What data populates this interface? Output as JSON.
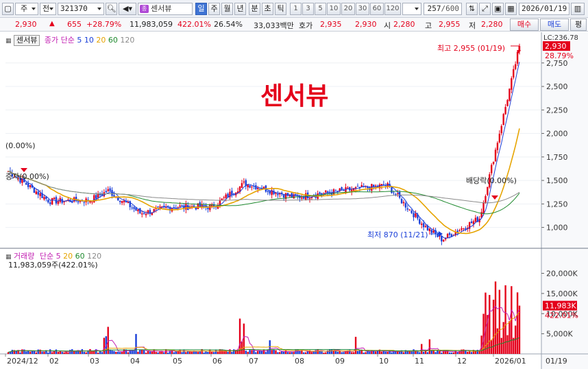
{
  "toolbar": {
    "period_type": "주",
    "market": "전",
    "code": "321370",
    "stock_name": "센서뷰",
    "name_badge": "종",
    "timeframes": [
      "일",
      "주",
      "월",
      "년",
      "분",
      "초",
      "틱"
    ],
    "active_timeframe": "일",
    "intervals": [
      "1",
      "3",
      "5",
      "10",
      "20",
      "30",
      "60",
      "120"
    ],
    "count": "257",
    "count_total": "/600",
    "date": "2026/01/19"
  },
  "quote": {
    "price": "2,930",
    "change": "655",
    "change_pct": "+28.79%",
    "volume": "11,983,059",
    "volume_pct": "422.01%",
    "turnover_pct": "26.54%",
    "trade_value": "33,033백만",
    "ask_label": "호가",
    "ask": "2,935",
    "bid": "2,930",
    "open_label": "시",
    "open": "2,280",
    "high_label": "고",
    "high": "2,955",
    "low_label": "저",
    "low": "2,280",
    "buy_label": "매수",
    "sell_label": "매도",
    "eval_label": "평"
  },
  "price_panel": {
    "tag": "센서뷰",
    "ma_label": "종가 단순",
    "ma_periods": [
      "5",
      "10",
      "20",
      "60",
      "120"
    ],
    "lc_label": "LC:236.78",
    "current_tag": "2,930",
    "current_pct": "28.79%",
    "big_title": "센서뷰",
    "high_annotation": "최고 2,955 (01/19)",
    "low_annotation": "최저 870 (11/21)",
    "rights_annotation": "(0.00%)",
    "rights_annotation2": "증자(0.00%)",
    "dividend_annotation": "배당락(0.00%)",
    "y_ticks": [
      "2,750",
      "2,500",
      "2,250",
      "2,000",
      "1,750",
      "1,500",
      "1,250",
      "1,000"
    ]
  },
  "volume_panel": {
    "title": "거래량",
    "ma_label": "단순",
    "ma_periods": [
      "5",
      "20",
      "60",
      "120"
    ],
    "volume_text": "11,983,059주(422.01%)",
    "current_tag": "11,983K",
    "current_pct": "422.01%",
    "y_ticks": [
      "20,000K",
      "15,000K",
      "10,000K",
      "5,000K"
    ]
  },
  "x_axis": {
    "labels": [
      "2024/12",
      "02",
      "03",
      "04",
      "05",
      "06",
      "07",
      "08",
      "09",
      "10",
      "11",
      "12",
      "2026/01"
    ],
    "right_label": "01/19"
  },
  "colors": {
    "up": "#e4001b",
    "down": "#1a3fd8",
    "ma5": "#1a3fd8",
    "ma10": "#1a3fd8",
    "ma20": "#e6a400",
    "ma60": "#1f8a2e",
    "ma120": "#8a8a8a"
  },
  "chart_data": {
    "type": "candlestick",
    "title": "센서뷰",
    "price_ylim": [
      800,
      2960
    ],
    "volume_ylim": [
      0,
      24000000
    ],
    "key_points": [
      {
        "date": "2024/12",
        "price": 1600
      },
      {
        "date": "2025/01",
        "price": 1280
      },
      {
        "date": "2025/02",
        "price": 1290
      },
      {
        "date": "2025/03",
        "price": 1390
      },
      {
        "date": "2025/04",
        "price": 1150
      },
      {
        "date": "2025/05",
        "price": 1220
      },
      {
        "date": "2025/06",
        "price": 1220
      },
      {
        "date": "2025/07",
        "price": 1470
      },
      {
        "date": "2025/08",
        "price": 1320
      },
      {
        "date": "2025/09",
        "price": 1380
      },
      {
        "date": "2025/10",
        "price": 1450
      },
      {
        "date": "2025/11",
        "price": 1010
      },
      {
        "date": "2025/11/21",
        "price": 870
      },
      {
        "date": "2025/12",
        "price": 1100
      },
      {
        "date": "2026/01",
        "price": 2200
      },
      {
        "date": "2026/01/19",
        "price": 2930
      }
    ],
    "high": {
      "date": "01/19",
      "value": 2955
    },
    "low": {
      "date": "11/21",
      "value": 870
    },
    "last_volume": 11983059
  }
}
